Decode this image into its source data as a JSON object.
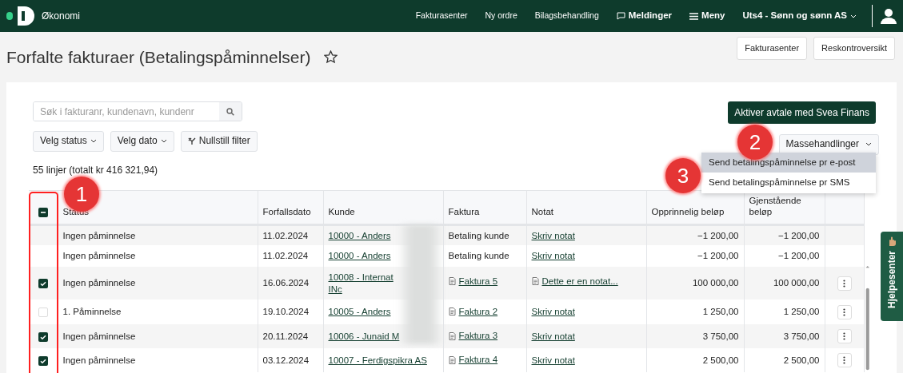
{
  "app": {
    "name": "Økonomi"
  },
  "nav": {
    "links": [
      {
        "label": "Fakturasenter",
        "kind": "plain"
      },
      {
        "label": "Ny ordre",
        "kind": "plain"
      },
      {
        "label": "Bilagsbehandling",
        "kind": "plain"
      },
      {
        "label": "Meldinger",
        "kind": "messages"
      },
      {
        "label": "Meny",
        "kind": "menu"
      }
    ],
    "company": "Uts4 - Sønn og sønn AS"
  },
  "page": {
    "title": "Forfalte fakturaer (Betalingspåminnelser)",
    "favorite": false,
    "header_buttons": [
      "Fakturasenter",
      "Reskontroversikt"
    ]
  },
  "toolbar": {
    "search_placeholder": "Søk i fakturanr, kundenavn, kundenr",
    "filters": [
      {
        "label": "Velg status",
        "kind": "dropdown"
      },
      {
        "label": "Velg dato",
        "kind": "dropdown"
      },
      {
        "label": "Nullstill filter",
        "kind": "reset"
      }
    ],
    "primary_button": "Aktiver avtale med Svea Finans",
    "bulk_button": "Massehandlinger",
    "bulk_menu": [
      {
        "label": "Send betalingspåminnelse pr e-post",
        "selected": true
      },
      {
        "label": "Send betalingspåminnelse pr SMS",
        "selected": false
      }
    ]
  },
  "summary": "55 linjer (totalt kr 416 321,94)",
  "table": {
    "select_all": {
      "partial": true
    },
    "columns": [
      "Status",
      "Forfallsdato",
      "Kunde",
      "Faktura",
      "Notat",
      "Opprinnelig beløp",
      "Gjenstående beløp"
    ],
    "rows": [
      {
        "status": "Ingen påminnelse",
        "due": "11.02.2024",
        "customer": "10000 - Anders",
        "invoice": {
          "text": "Betaling kunde",
          "kind": "plain"
        },
        "note": {
          "text": "Skriv notat",
          "kind": "link"
        },
        "original": "−1 200,00",
        "remaining": "−1 200,00",
        "menu": false
      },
      {
        "status": "Ingen påminnelse",
        "due": "11.02.2024",
        "customer": "10000 - Anders",
        "invoice": {
          "text": "Betaling kunde",
          "kind": "plain"
        },
        "note": {
          "text": "Skriv notat",
          "kind": "link"
        },
        "original": "−1 200,00",
        "remaining": "−1 200,00",
        "menu": false
      },
      {
        "checked": true,
        "status": "Ingen påminnelse",
        "due": "16.06.2024",
        "customer": "10008 - Internat\nINc",
        "invoice": {
          "text": "Faktura 5",
          "kind": "document"
        },
        "note": {
          "text": "Dette er en notat...",
          "kind": "document"
        },
        "original": "100 000,00",
        "remaining": "100 000,00",
        "menu": true
      },
      {
        "checked": false,
        "status": "1. Påminnelse",
        "due": "19.10.2024",
        "customer": "10005 - Anders",
        "invoice": {
          "text": "Faktura 2",
          "kind": "document"
        },
        "note": {
          "text": "Skriv notat",
          "kind": "link"
        },
        "original": "1 250,00",
        "remaining": "1 250,00",
        "menu": true
      },
      {
        "checked": true,
        "status": "Ingen påminnelse",
        "due": "20.11.2024",
        "customer": "10006 - Junaid M",
        "invoice": {
          "text": "Faktura 3",
          "kind": "document"
        },
        "note": {
          "text": "Skriv notat",
          "kind": "link"
        },
        "original": "3 750,00",
        "remaining": "3 750,00",
        "menu": true
      },
      {
        "checked": true,
        "status": "Ingen påminnelse",
        "due": "03.12.2024",
        "customer": "10007 - Ferdigspikra AS",
        "invoice": {
          "text": "Faktura 4",
          "kind": "document"
        },
        "note": {
          "text": "Skriv notat",
          "kind": "link"
        },
        "original": "2 500,00",
        "remaining": "2 500,00",
        "menu": true
      }
    ]
  },
  "callouts": [
    "1",
    "2",
    "3"
  ],
  "help_tab": "Hjelpesenter"
}
